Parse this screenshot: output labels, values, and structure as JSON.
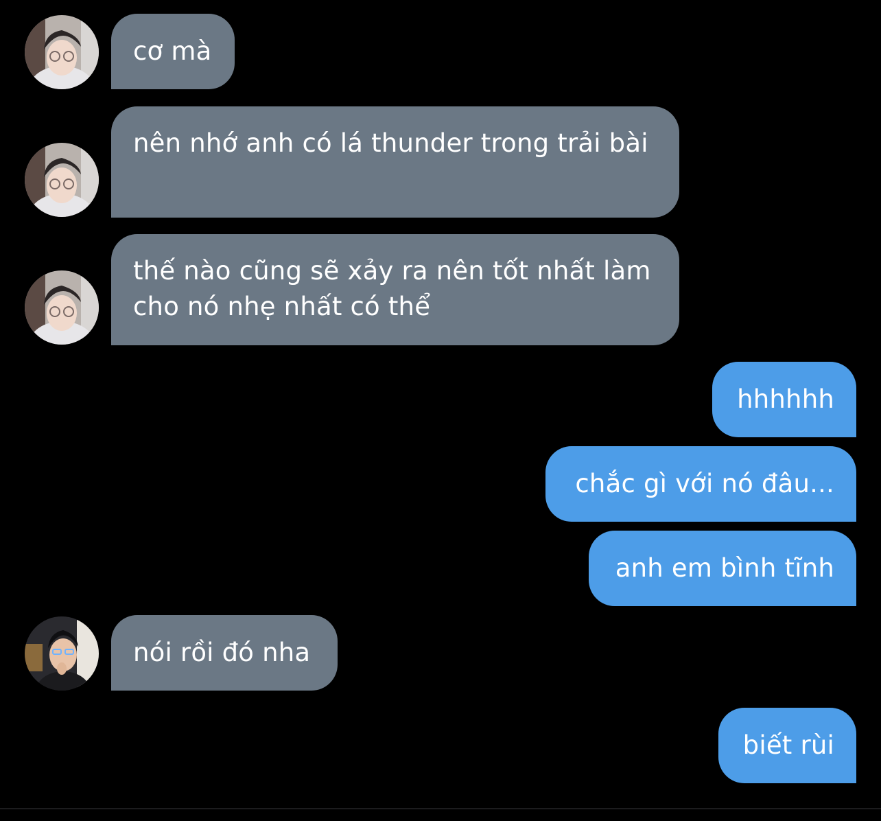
{
  "messages": [
    {
      "text": "cơ mà",
      "sender": "other",
      "avatar": "male-avatar-hoodie"
    },
    {
      "text": "nên nhớ anh có lá thunder trong trải bài",
      "sender": "other",
      "avatar": "male-avatar-hoodie"
    },
    {
      "text": "thế nào cũng sẽ xảy ra nên tốt nhất làm cho nó nhẹ nhất có thể",
      "sender": "other",
      "avatar": "male-avatar-hoodie"
    },
    {
      "text": "hhhhhh",
      "sender": "self"
    },
    {
      "text": "chắc gì với nó đâu...",
      "sender": "self"
    },
    {
      "text": "anh em bình tĩnh",
      "sender": "self"
    },
    {
      "text": "nói rồi đó nha",
      "sender": "other",
      "avatar": "male-avatar-dark-hair"
    },
    {
      "text": "biết rùi",
      "sender": "self"
    }
  ],
  "colors": {
    "background": "#000000",
    "incoming_bubble": "#6b7885",
    "outgoing_bubble": "#4d9de8",
    "text": "#ffffff"
  }
}
